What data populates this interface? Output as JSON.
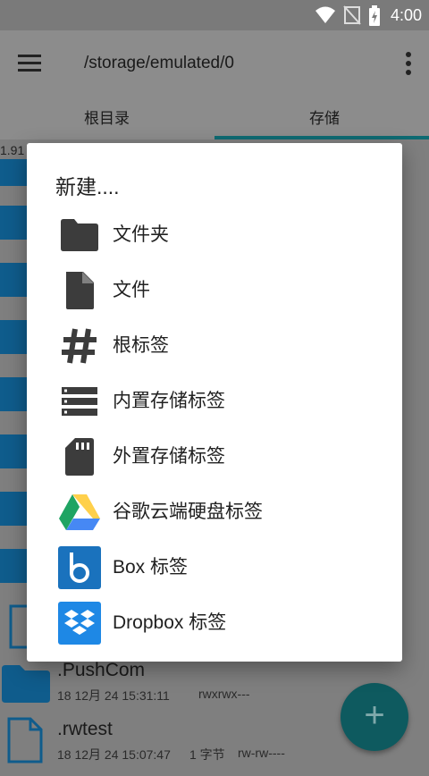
{
  "status_bar": {
    "time": "4:00"
  },
  "app_bar": {
    "path": "/storage/emulated/0"
  },
  "tabs": [
    {
      "label": "根目录"
    },
    {
      "label": "存储"
    }
  ],
  "background_list": {
    "truncated_text": "1.91",
    "items": [
      {
        "name": ".PushCom",
        "date": "18 12月 24 15:31:11",
        "perm": "rwxrwx---"
      },
      {
        "name": ".rwtest",
        "date": "18 12月 24 15:07:47",
        "size": "1 字节",
        "perm": "rw-rw----"
      }
    ]
  },
  "fab": {
    "label": "+"
  },
  "dialog": {
    "title": "新建....",
    "options": [
      {
        "label": "文件夹",
        "icon": "folder-icon"
      },
      {
        "label": "文件",
        "icon": "file-icon"
      },
      {
        "label": "根标签",
        "icon": "hash-icon"
      },
      {
        "label": "内置存储标签",
        "icon": "internal-storage-icon"
      },
      {
        "label": "外置存储标签",
        "icon": "sd-card-icon"
      },
      {
        "label": "谷歌云端硬盘标签",
        "icon": "google-drive-icon"
      },
      {
        "label": "Box 标签",
        "icon": "box-icon"
      },
      {
        "label": "Dropbox 标签",
        "icon": "dropbox-icon"
      }
    ]
  },
  "colors": {
    "accent": "#0e6b73",
    "folder": "#0f5c8c",
    "box_blue": "#1a72bd",
    "dropbox_blue": "#1e88e5",
    "drive_green": "#1fa463",
    "drive_yellow": "#ffd04b",
    "drive_blue": "#4688f4"
  }
}
